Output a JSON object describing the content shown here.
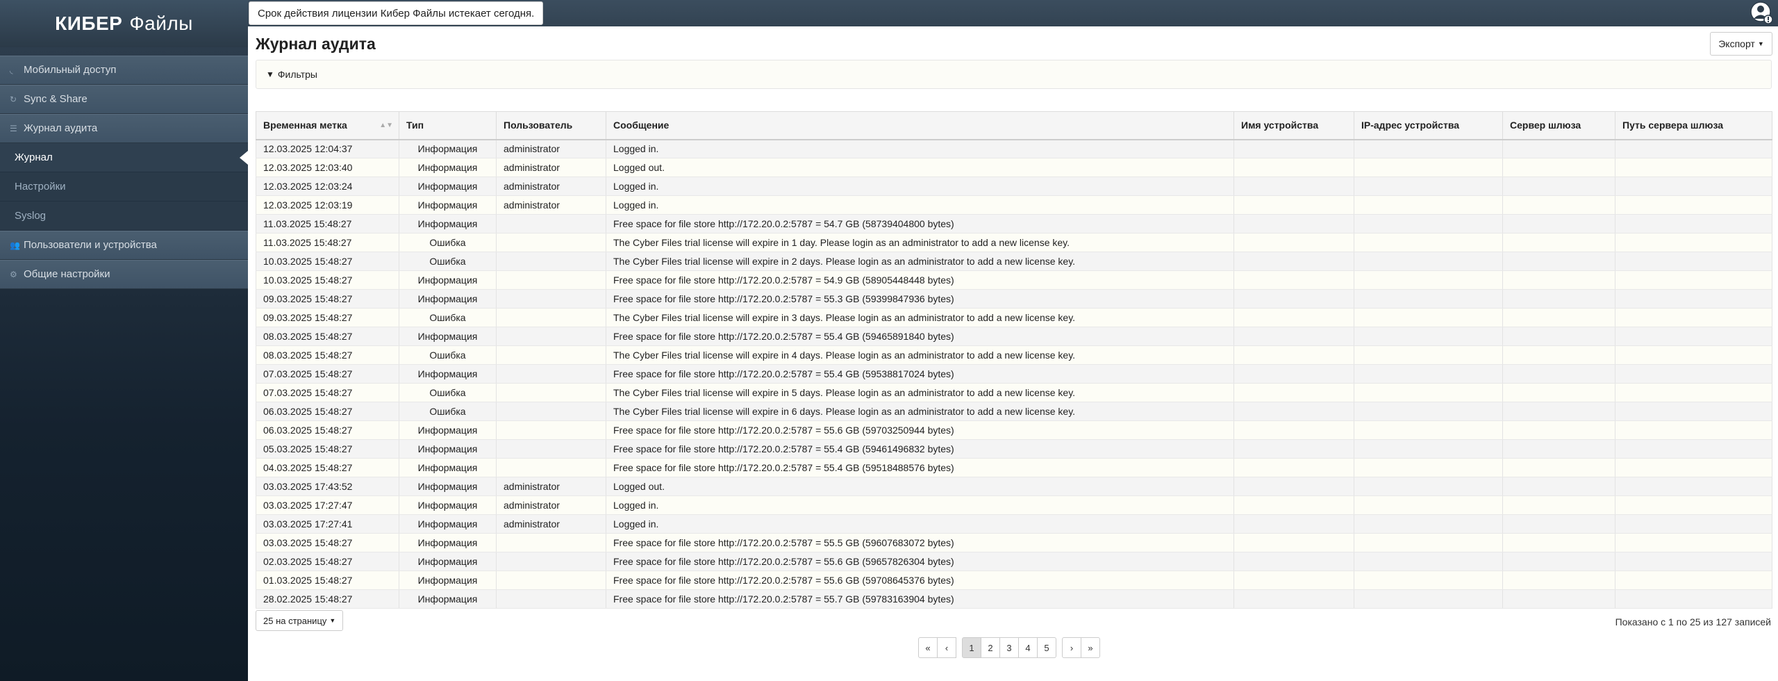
{
  "app": {
    "logo_bold": "КИБЕР",
    "logo_rest": "Файлы",
    "license_alert": "Срок действия лицензии Кибер Файлы истекает сегодня."
  },
  "sidebar": {
    "items": [
      {
        "label": "Мобильный доступ",
        "icon": "rss-icon"
      },
      {
        "label": "Sync & Share",
        "icon": "sync-icon"
      },
      {
        "label": "Журнал аудита",
        "icon": "list-icon"
      }
    ],
    "sub_items": [
      {
        "label": "Журнал",
        "active": true
      },
      {
        "label": "Настройки",
        "active": false
      },
      {
        "label": "Syslog",
        "active": false
      }
    ],
    "items_after": [
      {
        "label": "Пользователи и устройства",
        "icon": "users-icon"
      },
      {
        "label": "Общие настройки",
        "icon": "gears-icon"
      }
    ]
  },
  "main": {
    "title": "Журнал аудита",
    "export_label": "Экспорт",
    "filters_label": "Фильтры"
  },
  "table": {
    "columns": [
      "Временная метка",
      "Тип",
      "Пользователь",
      "Сообщение",
      "Имя устройства",
      "IP-адрес устройства",
      "Сервер шлюза",
      "Путь сервера шлюза"
    ],
    "rows": [
      [
        "12.03.2025 12:04:37",
        "Информация",
        "administrator",
        "Logged in.",
        "",
        "",
        "",
        ""
      ],
      [
        "12.03.2025 12:03:40",
        "Информация",
        "administrator",
        "Logged out.",
        "",
        "",
        "",
        ""
      ],
      [
        "12.03.2025 12:03:24",
        "Информация",
        "administrator",
        "Logged in.",
        "",
        "",
        "",
        ""
      ],
      [
        "12.03.2025 12:03:19",
        "Информация",
        "administrator",
        "Logged in.",
        "",
        "",
        "",
        ""
      ],
      [
        "11.03.2025 15:48:27",
        "Информация",
        "",
        "Free space for file store http://172.20.0.2:5787 = 54.7 GB (58739404800 bytes)",
        "",
        "",
        "",
        ""
      ],
      [
        "11.03.2025 15:48:27",
        "Ошибка",
        "",
        "The Cyber Files trial license will expire in 1 day. Please login as an administrator to add a new license key.",
        "",
        "",
        "",
        ""
      ],
      [
        "10.03.2025 15:48:27",
        "Ошибка",
        "",
        "The Cyber Files trial license will expire in 2 days. Please login as an administrator to add a new license key.",
        "",
        "",
        "",
        ""
      ],
      [
        "10.03.2025 15:48:27",
        "Информация",
        "",
        "Free space for file store http://172.20.0.2:5787 = 54.9 GB (58905448448 bytes)",
        "",
        "",
        "",
        ""
      ],
      [
        "09.03.2025 15:48:27",
        "Информация",
        "",
        "Free space for file store http://172.20.0.2:5787 = 55.3 GB (59399847936 bytes)",
        "",
        "",
        "",
        ""
      ],
      [
        "09.03.2025 15:48:27",
        "Ошибка",
        "",
        "The Cyber Files trial license will expire in 3 days. Please login as an administrator to add a new license key.",
        "",
        "",
        "",
        ""
      ],
      [
        "08.03.2025 15:48:27",
        "Информация",
        "",
        "Free space for file store http://172.20.0.2:5787 = 55.4 GB (59465891840 bytes)",
        "",
        "",
        "",
        ""
      ],
      [
        "08.03.2025 15:48:27",
        "Ошибка",
        "",
        "The Cyber Files trial license will expire in 4 days. Please login as an administrator to add a new license key.",
        "",
        "",
        "",
        ""
      ],
      [
        "07.03.2025 15:48:27",
        "Информация",
        "",
        "Free space for file store http://172.20.0.2:5787 = 55.4 GB (59538817024 bytes)",
        "",
        "",
        "",
        ""
      ],
      [
        "07.03.2025 15:48:27",
        "Ошибка",
        "",
        "The Cyber Files trial license will expire in 5 days. Please login as an administrator to add a new license key.",
        "",
        "",
        "",
        ""
      ],
      [
        "06.03.2025 15:48:27",
        "Ошибка",
        "",
        "The Cyber Files trial license will expire in 6 days. Please login as an administrator to add a new license key.",
        "",
        "",
        "",
        ""
      ],
      [
        "06.03.2025 15:48:27",
        "Информация",
        "",
        "Free space for file store http://172.20.0.2:5787 = 55.6 GB (59703250944 bytes)",
        "",
        "",
        "",
        ""
      ],
      [
        "05.03.2025 15:48:27",
        "Информация",
        "",
        "Free space for file store http://172.20.0.2:5787 = 55.4 GB (59461496832 bytes)",
        "",
        "",
        "",
        ""
      ],
      [
        "04.03.2025 15:48:27",
        "Информация",
        "",
        "Free space for file store http://172.20.0.2:5787 = 55.4 GB (59518488576 bytes)",
        "",
        "",
        "",
        ""
      ],
      [
        "03.03.2025 17:43:52",
        "Информация",
        "administrator",
        "Logged out.",
        "",
        "",
        "",
        ""
      ],
      [
        "03.03.2025 17:27:47",
        "Информация",
        "administrator",
        "Logged in.",
        "",
        "",
        "",
        ""
      ],
      [
        "03.03.2025 17:27:41",
        "Информация",
        "administrator",
        "Logged in.",
        "",
        "",
        "",
        ""
      ],
      [
        "03.03.2025 15:48:27",
        "Информация",
        "",
        "Free space for file store http://172.20.0.2:5787 = 55.5 GB (59607683072 bytes)",
        "",
        "",
        "",
        ""
      ],
      [
        "02.03.2025 15:48:27",
        "Информация",
        "",
        "Free space for file store http://172.20.0.2:5787 = 55.6 GB (59657826304 bytes)",
        "",
        "",
        "",
        ""
      ],
      [
        "01.03.2025 15:48:27",
        "Информация",
        "",
        "Free space for file store http://172.20.0.2:5787 = 55.6 GB (59708645376 bytes)",
        "",
        "",
        "",
        ""
      ],
      [
        "28.02.2025 15:48:27",
        "Информация",
        "",
        "Free space for file store http://172.20.0.2:5787 = 55.7 GB (59783163904 bytes)",
        "",
        "",
        "",
        ""
      ]
    ]
  },
  "footer": {
    "per_page_label": "25 на страницу",
    "showing_text": "Показано с 1 по 25 из 127 записей",
    "pages": [
      "1",
      "2",
      "3",
      "4",
      "5"
    ],
    "current_page": "1"
  },
  "colors": {
    "topbar": "#2c3b49",
    "sidebar": "#15222f",
    "row_odd": "#f4f4f4",
    "row_even": "#fdfdf6"
  }
}
